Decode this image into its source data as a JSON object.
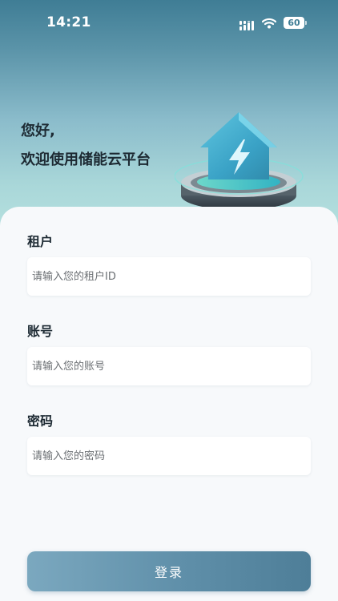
{
  "status_bar": {
    "time": "14:21",
    "battery_level": "60",
    "icons": [
      "signal-icon",
      "wifi-icon",
      "battery-icon"
    ]
  },
  "header": {
    "greeting_line1": "您好,",
    "greeting_line2": "欢迎使用储能云平台",
    "illustration": "energy-storage-house-lightning-icon"
  },
  "form": {
    "tenant": {
      "label": "租户",
      "placeholder": "请输入您的租户ID",
      "value": ""
    },
    "account": {
      "label": "账号",
      "placeholder": "请输入您的账号",
      "value": ""
    },
    "password": {
      "label": "密码",
      "placeholder": "请输入您的密码",
      "value": ""
    }
  },
  "actions": {
    "login_label": "登录"
  },
  "colors": {
    "header_top": "#3f7d95",
    "header_bottom": "#b8e2e0",
    "button_start": "#7ba8bf",
    "button_end": "#4e7e98"
  }
}
